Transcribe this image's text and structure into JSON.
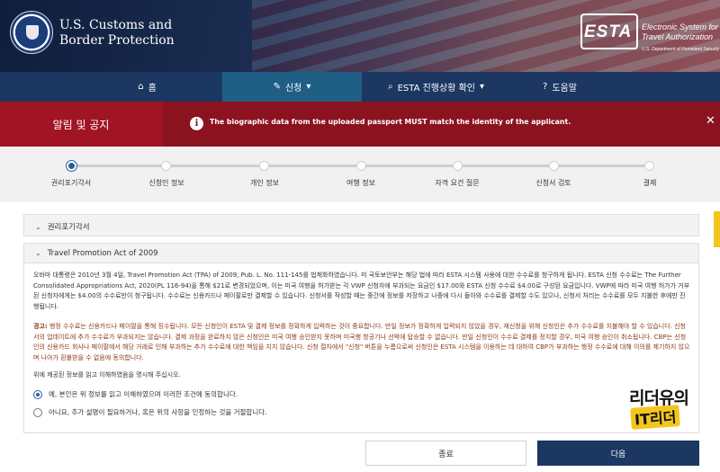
{
  "header": {
    "agency_line1": "U.S. Customs and",
    "agency_line2": "Border Protection",
    "esta_logo": "ESTA",
    "esta_sub1": "Electronic System for",
    "esta_sub2": "Travel Authorization",
    "esta_dhs": "U.S. Department of Homeland Security"
  },
  "nav": {
    "home": "홈",
    "apply": "신청",
    "check_status": "ESTA 진행상황 확인",
    "help": "도움말",
    "home_icon": "home-icon",
    "apply_icon": "pencil-icon",
    "status_icon": "search-icon",
    "help_icon": "question-circle-icon"
  },
  "alert": {
    "label": "알림 및 공지",
    "message": "The biographic data from the uploaded passport MUST match the identity of the applicant.",
    "color": "#8b1320"
  },
  "progress": {
    "steps": [
      "권리포기각서",
      "신청인 정보",
      "개인 정보",
      "여행 정보",
      "자격 요건 질문",
      "신청서 검토",
      "결제"
    ],
    "current_step": 1
  },
  "sections": {
    "waiver_title": "권리포기각서",
    "tpa_title": "Travel Promotion Act of 2009",
    "tpa_paragraph": "오바마 대통령은 2010년 3월 4일, Travel Promotion Act (TPA) of 2009, Pub. L. No. 111-145를 법제화하였습니다. 미 국토보안부는 해당 법에 따라 ESTA 시스템 사용에 대한 수수료를 청구하게 됩니다. ESTA 신청 수수료는 The Further Consolidated Appropriations Act, 2020(PL 116-94)을 통해 $21로 변경되었으며, 이는 미국 여행을 허가받는 각 VWP 신청자에 부과되는 요금인 $17.00와 ESTA 신청 수수료 $4.00로 구성된 요금입니다. VWP에 따라 미국 여행 허가가 거부된 신청자에게는 $4.00의 수수료만이 청구됩니다. 수수료는 신용카드나 페이팔로만 결제할 수 있습니다. 신청서를 작성할 때는 중간에 정보를 저장하고 나중에 다시 돌아와 수수료를 결제할 수도 있으나, 신청서 처리는 수수료를 모두 지불한 후에만 진행됩니다.",
    "warning_label": "경고:",
    "warning_text": " 행정 수수료는 신용카드나 페이팔을 통해 징수됩니다. 모든 신청인이 ESTA 및 결제 정보를 정확하게 입력하는 것이 중요합니다. 만일 정보가 정확하게 입력되지 않았을 경우, 재신청을 위해 신청인은 추가 수수료를 지불해야 할 수 있습니다. 신청서의 업데이트에 추가 수수료가 부과되지는 않습니다. 결제 과정을 완료하지 않은 신청인은 미국 여행 승인받지 못하며 미국행 항공기나 선박에 탑승할 수 없습니다. 만일 신청인이 수수료 결제를 정지할 경우, 미국 여행 승인이 취소됩니다. CBP는 신청인의 신용카드 회사나 페이팔에서 해당 거래로 인해 부과하는 추가 수수료에 대한 책임을 지지 않습니다. 신청 절차에서 \"신청\" 버튼을 누름으로써 신청인은 ESTA 시스템을 이용하는 데 대하여 CBP가 부과하는 행정 수수료에 대해 이의를 제기하지 않으며 나아가 환불받을 수 없음에 동의합니다.",
    "confirm_prompt": "위에 제공된 정보를 읽고 이해하였음을 명시해 주십시오.",
    "option_agree": "예, 본인은 위 정보를 읽고 이해하였으며 이러한 조건에 동의합니다.",
    "option_disagree": "아니요, 추가 설명이 필요하거나, 혹은 위의 사항을 인정하는 것을 거절합니다.",
    "selected_option": "agree"
  },
  "watermark": {
    "line1": "리더유의",
    "line2": "IT리더"
  },
  "buttons": {
    "close": "종료",
    "next": "다음"
  }
}
